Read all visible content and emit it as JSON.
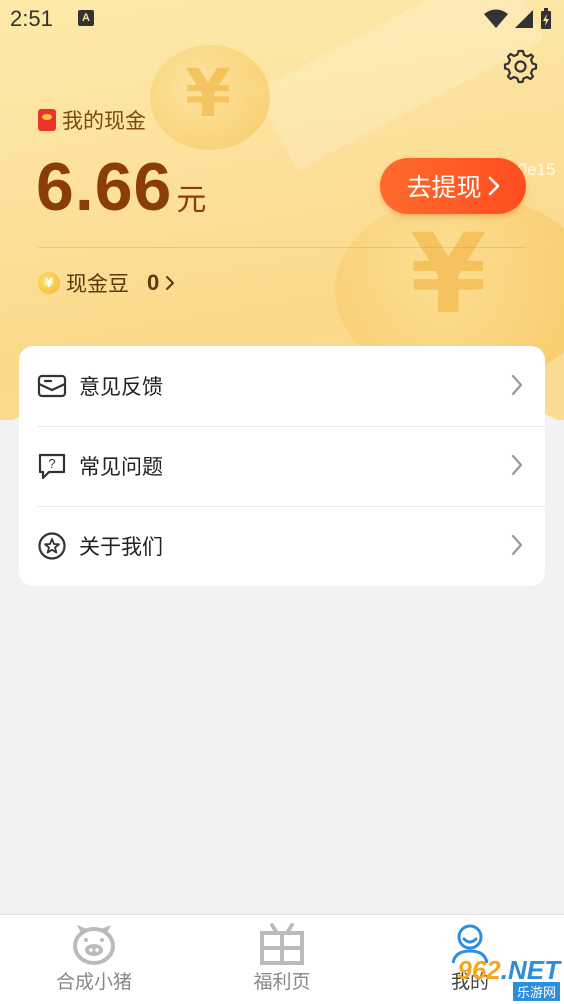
{
  "status_bar": {
    "time": "2:51",
    "notification_letter": "A"
  },
  "header": {
    "cash_label": "我的现金",
    "cash_amount": "6.66",
    "cash_unit": "元",
    "withdraw_label": "去提现",
    "id_text": "ID:1a0e15",
    "bean_label": "现金豆",
    "bean_count": "0",
    "bean_symbol": "¥"
  },
  "menu": {
    "items": [
      {
        "label": "意见反馈",
        "icon": "feedback-mail-icon"
      },
      {
        "label": "常见问题",
        "icon": "faq-question-icon"
      },
      {
        "label": "关于我们",
        "icon": "star-circle-icon"
      }
    ]
  },
  "bottom_nav": {
    "items": [
      {
        "label": "合成小猪",
        "icon": "pig-icon",
        "active": false
      },
      {
        "label": "福利页",
        "icon": "gift-box-icon",
        "active": false
      },
      {
        "label": "我的",
        "icon": "user-icon",
        "active": true
      }
    ]
  },
  "watermark": {
    "top": "962",
    "suffix": ".NET",
    "bottom": "乐游网"
  },
  "colors": {
    "accent": "#ff5a25",
    "cash_text": "#8a3d05",
    "header_bg": "#fde3a0"
  }
}
